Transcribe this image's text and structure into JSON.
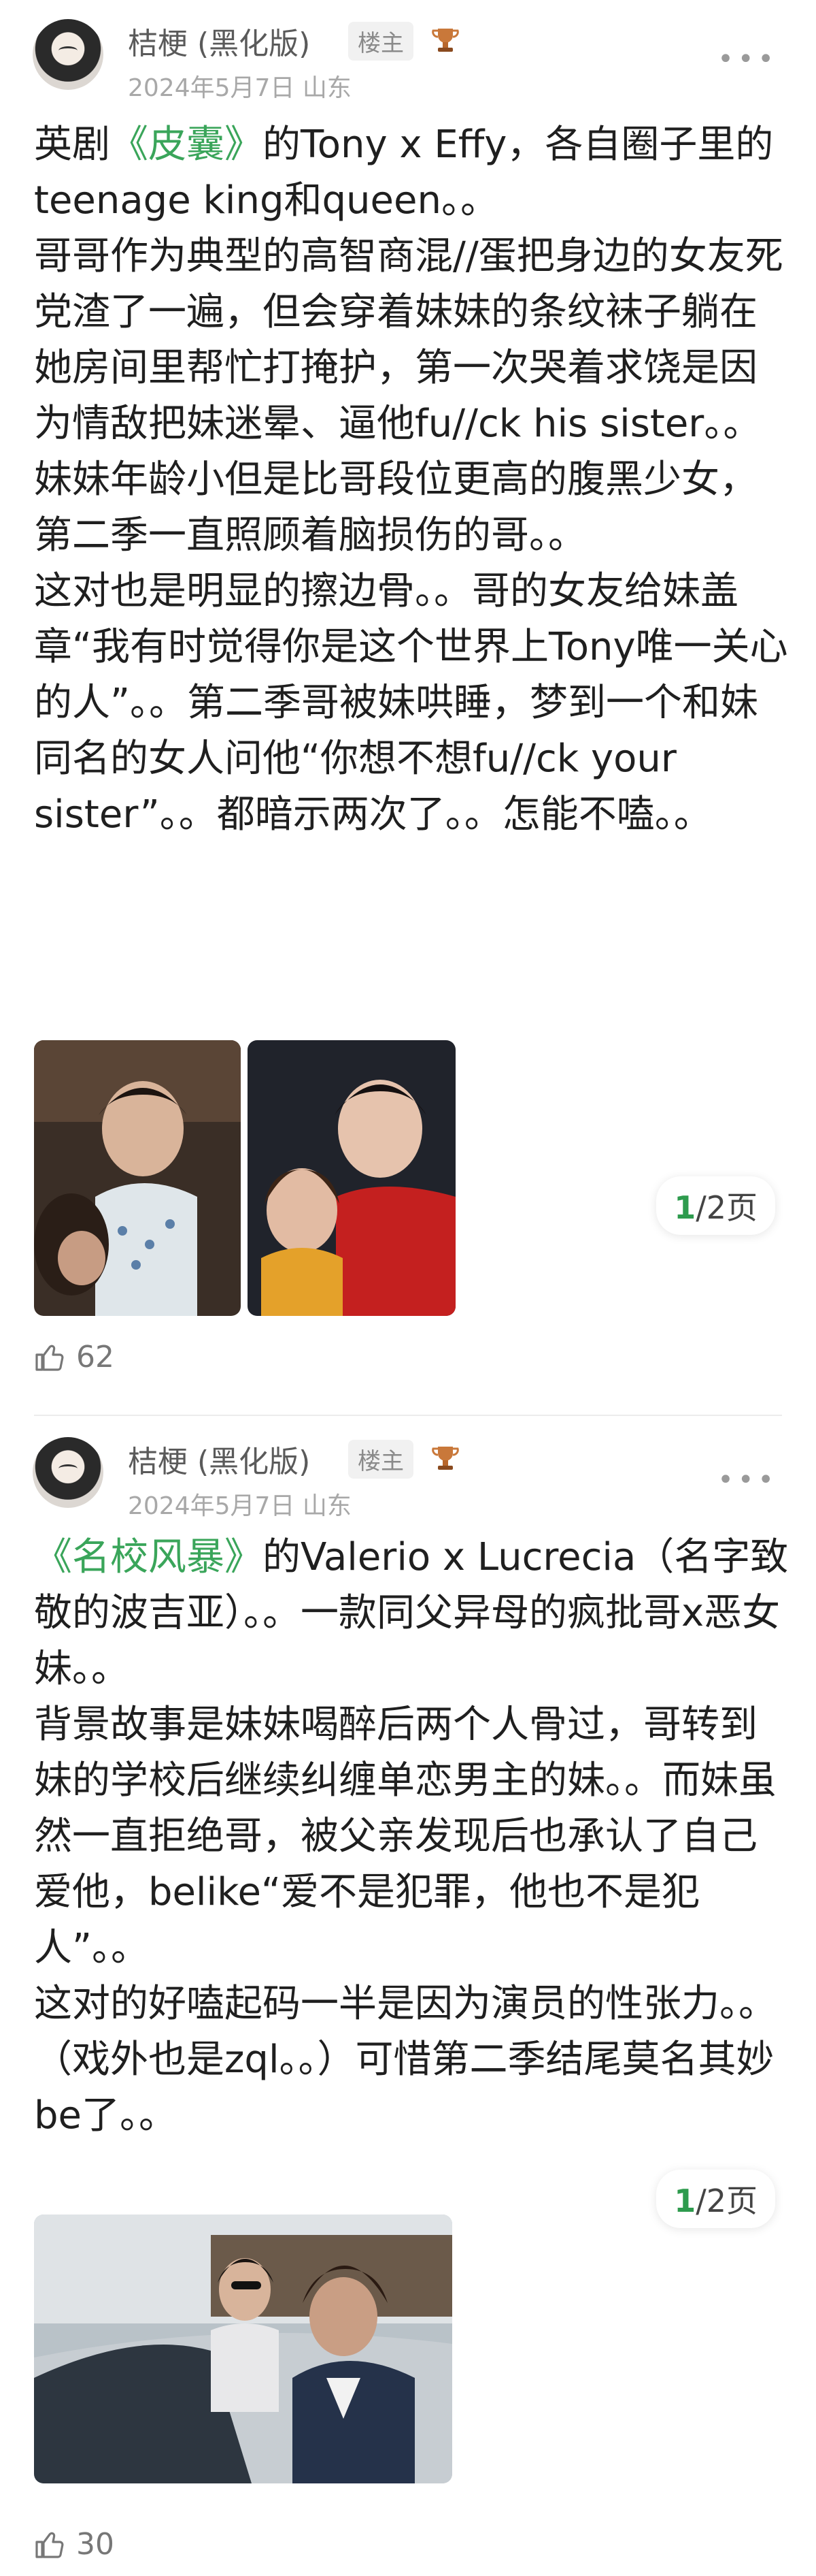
{
  "posts": [
    {
      "author": "桔梗 (黑化版)",
      "badge": "楼主",
      "meta": "2024年5月7日 山东",
      "paragraphs": [
        {
          "link": "《皮囊》",
          "text_before": "英剧",
          "text_after": "的Tony x Effy，各自圈子里的teenage king和queen。。"
        },
        {
          "text": "哥哥作为典型的高智商混//蛋把身边的女友死党渣了一遍，但会穿着妹妹的条纹袜子躺在她房间里帮忙打掩护，第一次哭着求饶是因为情敌把妹迷晕、逼他fu//ck his sister。。妹妹年龄小但是比哥段位更高的腹黑少女，第二季一直照顾着脑损伤的哥。。"
        },
        {
          "text": "这对也是明显的擦边骨。。哥的女友给妹盖章“我有时觉得你是这个世界上Tony唯一关心的人”。。第二季哥被妹哄睡，梦到一个和妹同名的女人问他“你想不想fu//ck your sister”。。都暗示两次了。。怎能不嗑。。"
        }
      ],
      "pager": {
        "current": "1",
        "total": "/2页"
      },
      "likes": "62"
    },
    {
      "author": "桔梗 (黑化版)",
      "badge": "楼主",
      "meta": "2024年5月7日 山东",
      "paragraphs": [
        {
          "link": "《名校风暴》",
          "text_before": "",
          "text_after": "的Valerio x Lucrecia（名字致敬的波吉亚）。。一款同父异母的疯批哥x恶女妹。。"
        },
        {
          "text": "背景故事是妹妹喝醉后两个人骨过，哥转到妹的学校后继续纠缠单恋男主的妹。。而妹虽然一直拒绝哥，被父亲发现后也承认了自己爱他，belike“爱不是犯罪，他也不是犯人”。。"
        },
        {
          "text": "这对的好嗑起码一半是因为演员的性张力。。（戏外也是zql。。）可惜第二季结尾莫名其妙be了。。"
        }
      ],
      "pager": {
        "current": "1",
        "total": "/2页"
      },
      "likes": "30"
    }
  ],
  "icons": {
    "more": "more-dots-icon",
    "like": "thumbs-up-icon",
    "badge_decor": "trophy-icon"
  },
  "colors": {
    "link": "#3aa55a",
    "pager_current": "#2e9b4e"
  }
}
